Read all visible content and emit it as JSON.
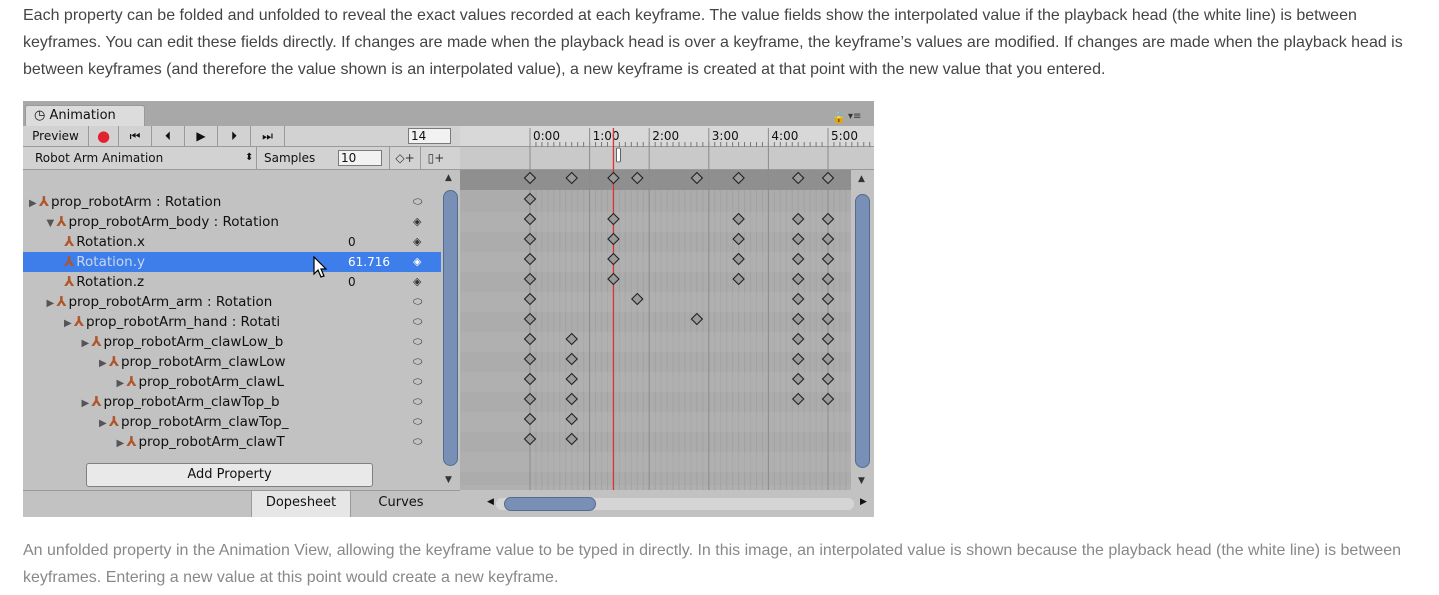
{
  "doc": {
    "paragraph": "Each property can be folded and unfolded to reveal the exact values recorded at each keyframe. The value fields show the interpolated value if the playback head (the white line) is between keyframes. You can edit these fields directly. If changes are made when the playback head is over a keyframe, the keyframe’s values are modified. If changes are made when the playback head is between keyframes (and therefore the value shown is an interpolated value), a new keyframe is created at that point with the new value that you entered.",
    "caption": "An unfolded property in the Animation View, allowing the keyframe value to be typed in directly. In this image, an interpolated value is shown because the playback head (the white line) is between keyframes. Entering a new value at this point would create a new keyframe."
  },
  "window": {
    "tab_icon": "◷",
    "tab_label": "Animation",
    "lock_icon": "🔒",
    "menu_icon": "▾≡"
  },
  "toolbar": {
    "preview_label": "Preview",
    "record_icon": "●",
    "first_key_icon": "⏮",
    "prev_key_icon": "⏴",
    "play_icon": "▶",
    "next_key_icon": "⏵",
    "last_key_icon": "⏭",
    "frame_value": "14"
  },
  "clip": {
    "name": "Robot Arm Animation",
    "dropdown_icon": "⬍",
    "samples_label": "Samples",
    "samples_value": "10",
    "add_keyframe_icon": "◇+",
    "add_event_icon": "▯+"
  },
  "properties": [
    {
      "label": "prop_robotArm : Rotation",
      "indent": 0,
      "foldout": "▶",
      "value": "",
      "icon": "⬭"
    },
    {
      "label": "prop_robotArm_body : Rotation",
      "indent": 1,
      "foldout": "▼",
      "value": "",
      "icon": "◈"
    },
    {
      "label": "Rotation.x",
      "indent": 2,
      "foldout": "",
      "value": "0",
      "icon": "◈"
    },
    {
      "label": "Rotation.y",
      "indent": 2,
      "foldout": "",
      "value": "61.716",
      "icon": "◈",
      "selected": true
    },
    {
      "label": "Rotation.z",
      "indent": 2,
      "foldout": "",
      "value": "0",
      "icon": "◈"
    },
    {
      "label": "prop_robotArm_arm : Rotation",
      "indent": 1,
      "foldout": "▶",
      "value": "",
      "icon": "⬭"
    },
    {
      "label": "prop_robotArm_hand : Rotati",
      "indent": 2,
      "foldout": "▶",
      "value": "",
      "icon": "⬭"
    },
    {
      "label": "prop_robotArm_clawLow_b",
      "indent": 3,
      "foldout": "▶",
      "value": "",
      "icon": "⬭"
    },
    {
      "label": "prop_robotArm_clawLow",
      "indent": 4,
      "foldout": "▶",
      "value": "",
      "icon": "⬭"
    },
    {
      "label": "prop_robotArm_clawL",
      "indent": 5,
      "foldout": "▶",
      "value": "",
      "icon": "⬭"
    },
    {
      "label": "prop_robotArm_clawTop_b",
      "indent": 3,
      "foldout": "▶",
      "value": "",
      "icon": "⬭"
    },
    {
      "label": "prop_robotArm_clawTop_",
      "indent": 4,
      "foldout": "▶",
      "value": "",
      "icon": "⬭"
    },
    {
      "label": "prop_robotArm_clawT",
      "indent": 5,
      "foldout": "▶",
      "value": "",
      "icon": "⬭"
    }
  ],
  "axis_icon": "⅄",
  "add_property_label": "Add Property",
  "bottom_tabs": {
    "dopesheet": "Dopesheet",
    "curves": "Curves"
  },
  "scroll_icons": {
    "up": "▲",
    "down": "▼",
    "left": "◀",
    "right": "▶"
  },
  "timeline": {
    "tick_labels": [
      "0:00",
      "1:00",
      "2:00",
      "3:00",
      "4:00",
      "5:00"
    ],
    "frames_per_second": 60,
    "playhead_seconds": 1.4,
    "red_line_seconds": 1.4,
    "summary_keys_seconds": [
      0,
      0.7,
      1.4,
      1.8,
      2.8,
      3.5,
      4.5,
      5.0
    ],
    "row_keys_seconds": [
      [
        0
      ],
      [
        0,
        1.4,
        3.5,
        4.5,
        5.0
      ],
      [
        0,
        1.4,
        3.5,
        4.5,
        5.0
      ],
      [
        0,
        1.4,
        3.5,
        4.5,
        5.0
      ],
      [
        0,
        1.4,
        3.5,
        4.5,
        5.0
      ],
      [
        0,
        1.8,
        4.5,
        5.0
      ],
      [
        0,
        2.8,
        4.5,
        5.0
      ],
      [
        0,
        0.7,
        4.5,
        5.0
      ],
      [
        0,
        0.7,
        4.5,
        5.0
      ],
      [
        0,
        0.7,
        4.5,
        5.0
      ],
      [
        0,
        0.7,
        4.5,
        5.0
      ],
      [
        0,
        0.7
      ],
      [
        0,
        0.7
      ]
    ]
  },
  "colors": {
    "selection": "#3d7eea",
    "record": "#e0232d",
    "playhead_red": "#e03030",
    "scroll_thumb": "#7990b6",
    "axis_icon": "#b05528"
  }
}
